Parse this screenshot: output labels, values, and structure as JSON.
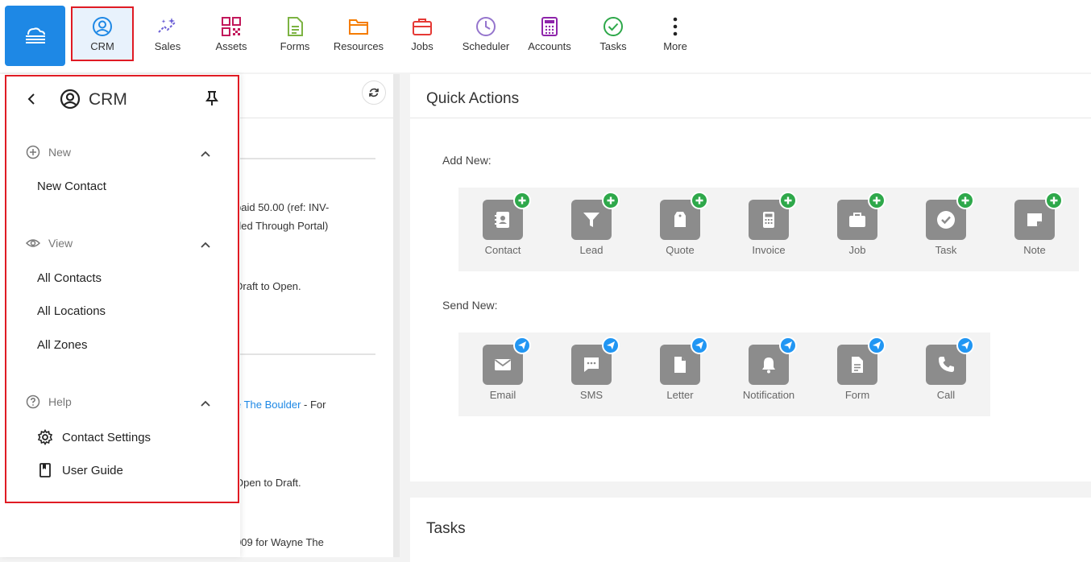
{
  "nav": {
    "items": [
      {
        "label": "CRM"
      },
      {
        "label": "Sales"
      },
      {
        "label": "Assets"
      },
      {
        "label": "Forms"
      },
      {
        "label": "Resources"
      },
      {
        "label": "Jobs"
      },
      {
        "label": "Scheduler"
      },
      {
        "label": "Accounts"
      },
      {
        "label": "Tasks"
      },
      {
        "label": "More"
      }
    ],
    "accent": "#1e88e5",
    "highlight": "#e01b24"
  },
  "flyout": {
    "title": "CRM",
    "groups": {
      "new": {
        "label": "New",
        "items": [
          "New Contact"
        ]
      },
      "view": {
        "label": "View",
        "items": [
          "All Contacts",
          "All Locations",
          "All Zones"
        ]
      },
      "help": {
        "label": "Help",
        "items": [
          "Contact Settings",
          "User Guide"
        ]
      }
    }
  },
  "activity": {
    "line1": "paid 50.00 (ref: INV-",
    "line2": "ded Through Portal)",
    "line3": "Draft to Open.",
    "line4_link": "e The Boulder",
    "line4_rest": " - For",
    "line5": "Open to Draft.",
    "line6": "009 for Wayne The"
  },
  "quick_actions": {
    "title": "Quick Actions",
    "add_label": "Add New:",
    "add_items": [
      "Contact",
      "Lead",
      "Quote",
      "Invoice",
      "Job",
      "Task",
      "Note"
    ],
    "send_label": "Send New:",
    "send_items": [
      "Email",
      "SMS",
      "Letter",
      "Notification",
      "Form",
      "Call"
    ]
  },
  "tasks": {
    "title": "Tasks"
  }
}
